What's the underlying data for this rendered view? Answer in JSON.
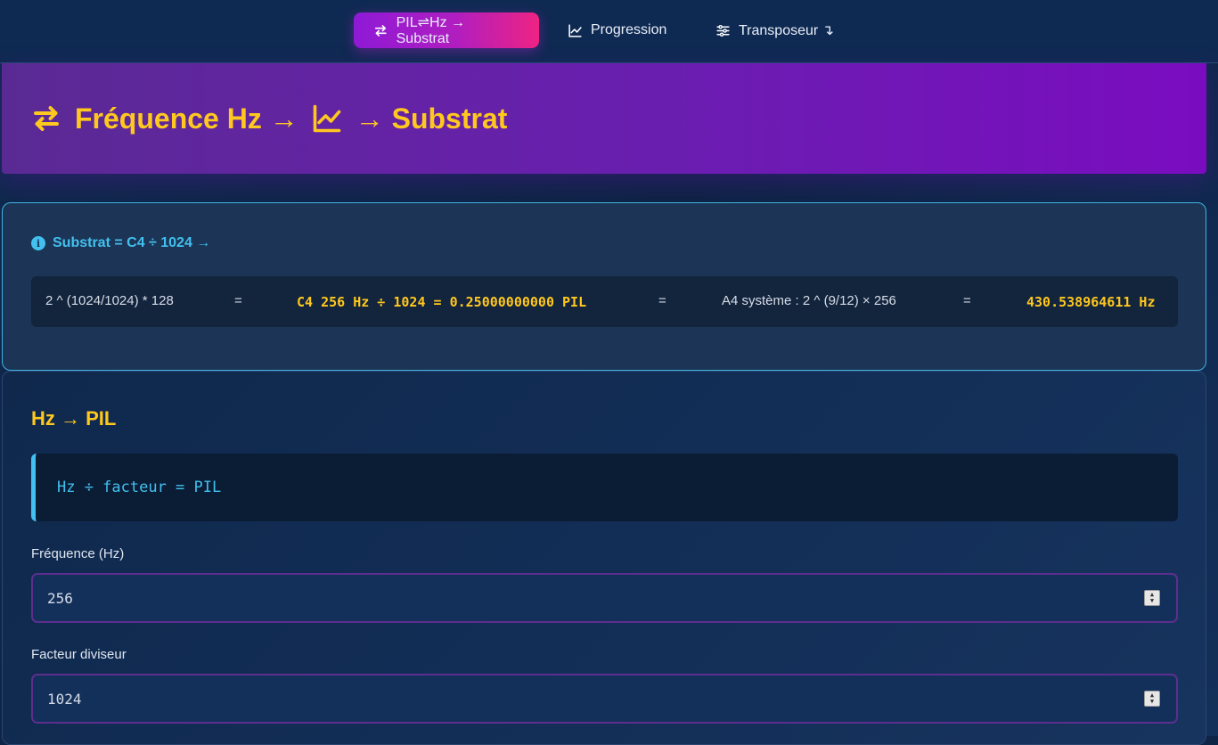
{
  "nav": {
    "tabs": [
      {
        "label": "PIL⇌Hz → Substrat",
        "icon": "arrows-exchange-icon",
        "active": true
      },
      {
        "label": "Progression",
        "icon": "chart-line-icon",
        "active": false
      },
      {
        "label": "Transposeur ↴",
        "icon": "sliders-icon",
        "active": false
      }
    ]
  },
  "hero": {
    "title_part1": "Fréquence Hz →",
    "title_part2": "→ Substrat"
  },
  "info": {
    "heading": "Substrat = C4 ÷ 1024 →",
    "formula": {
      "expr1": "2 ^ (1024/1024) * 128",
      "eq1": "=",
      "result1": "C4 256 Hz ÷ 1024 = 0.25000000000 PIL",
      "eq2": "=",
      "expr2": "A4 système : 2 ^ (9/12) × 256",
      "eq3": "=",
      "result2": "430.538964611 Hz"
    }
  },
  "main": {
    "title": "Hz → PIL",
    "code": "Hz ÷ facteur = PIL",
    "frequency_label": "Fréquence (Hz)",
    "frequency_value": "256",
    "factor_label": "Facteur diviseur",
    "factor_value": "1024"
  },
  "colors": {
    "accent_yellow": "#ffc81e",
    "accent_cyan": "#42c0ef",
    "hero_purple": "#6a1eb0",
    "tab_gradient_end": "#ee2383"
  }
}
